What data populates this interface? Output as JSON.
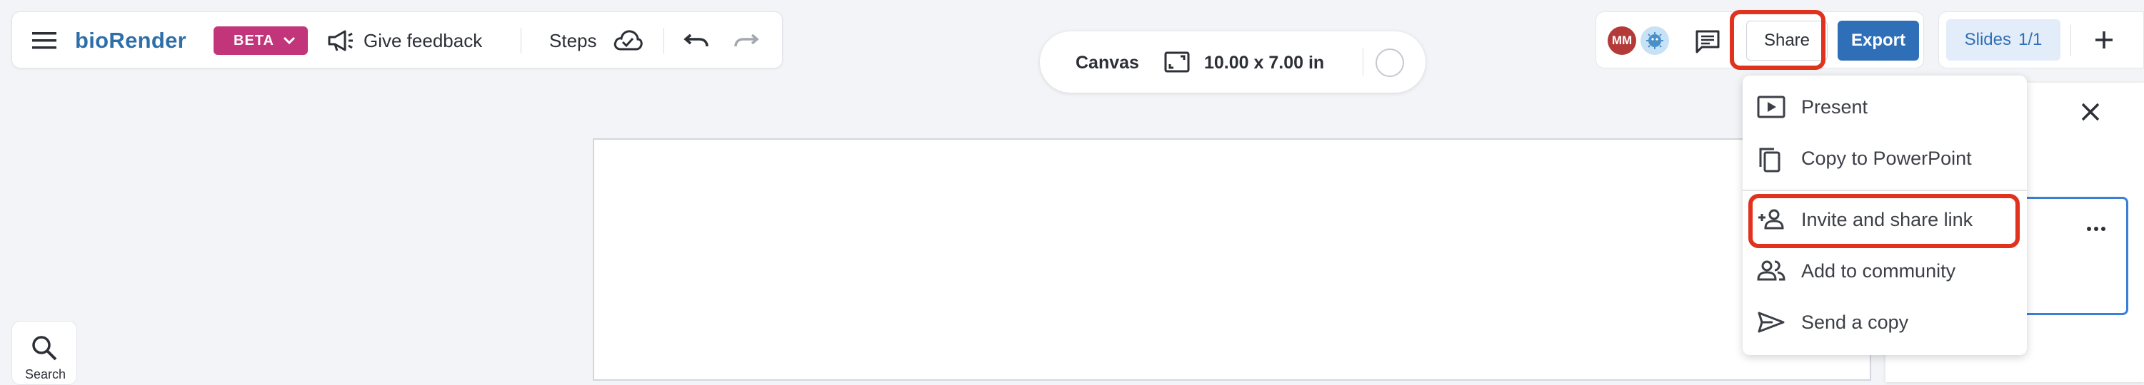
{
  "app": {
    "logo": "bioRender",
    "beta_label": "BETA",
    "feedback_label": "Give feedback",
    "steps_label": "Steps"
  },
  "canvas_bar": {
    "label": "Canvas",
    "size": "10.00 x 7.00 in"
  },
  "collab": {
    "avatar_initials": "MM"
  },
  "actions": {
    "share_label": "Share",
    "export_label": "Export"
  },
  "slides": {
    "label": "Slides",
    "count": "1/1"
  },
  "share_menu": {
    "items": [
      {
        "label": "Present",
        "icon": "play-icon"
      },
      {
        "label": "Copy to PowerPoint",
        "icon": "copy-icon"
      },
      {
        "label": "Invite and share link",
        "icon": "person-add-icon"
      },
      {
        "label": "Add to community",
        "icon": "people-icon"
      },
      {
        "label": "Send a copy",
        "icon": "send-icon"
      }
    ]
  },
  "search": {
    "label": "Search"
  },
  "colors": {
    "brand": "#2f6fa8",
    "beta": "#c2357a",
    "export": "#2f6fb8",
    "highlight": "#e0321c"
  }
}
